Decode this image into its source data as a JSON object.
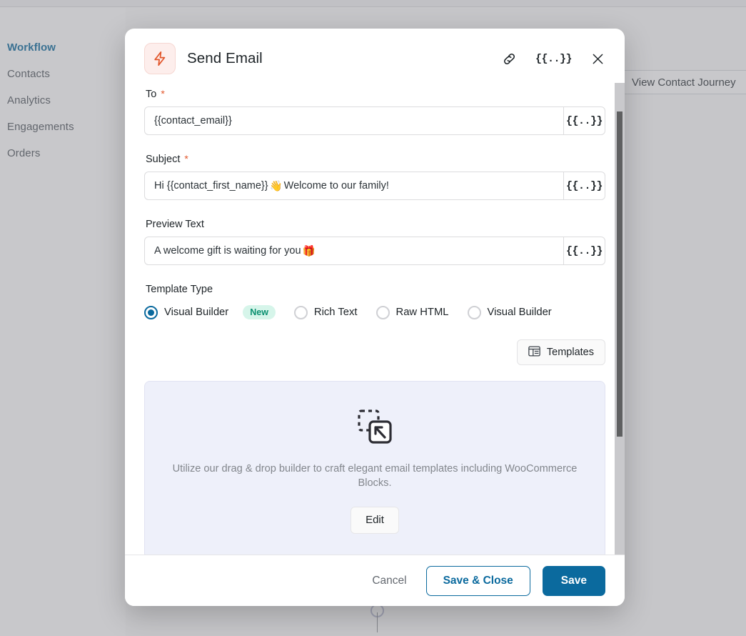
{
  "background": {
    "sidebar": {
      "items": [
        {
          "label": "Workflow",
          "active": true
        },
        {
          "label": "Contacts",
          "active": false
        },
        {
          "label": "Analytics",
          "active": false
        },
        {
          "label": "Engagements",
          "active": false
        },
        {
          "label": "Orders",
          "active": false
        }
      ]
    },
    "canvas": {
      "view_journey_label": "View Contact Journey"
    }
  },
  "modal": {
    "icon": "lightning-bolt-icon",
    "title": "Send Email",
    "header_actions": {
      "link_icon": "link-icon",
      "merge_tag_icon": "{{..}}",
      "close_icon": "close-icon"
    },
    "fields": {
      "to": {
        "label": "To",
        "required": "*",
        "value": "{{contact_email}}",
        "tag_button": "{{..}}"
      },
      "subject": {
        "label": "Subject",
        "required": "*",
        "value_before": "Hi {{contact_first_name}}",
        "emoji": "👋",
        "value_after": "Welcome to our family!",
        "tag_button": "{{..}}"
      },
      "preview_text": {
        "label": "Preview Text",
        "value_before": "A welcome gift is waiting for you",
        "emoji": "🎁",
        "tag_button": "{{..}}"
      }
    },
    "template_type": {
      "label": "Template Type",
      "options": [
        {
          "label": "Visual Builder",
          "checked": true,
          "badge": "New"
        },
        {
          "label": "Rich Text",
          "checked": false,
          "badge": ""
        },
        {
          "label": "Raw HTML",
          "checked": false,
          "badge": ""
        },
        {
          "label": "Visual Builder",
          "checked": false,
          "badge": ""
        }
      ]
    },
    "templates_button": {
      "label": "Templates",
      "icon": "layout-template-icon"
    },
    "preview_panel": {
      "icon": "drag-drop-icon",
      "description": "Utilize our drag & drop builder to craft elegant email templates including WooCommerce Blocks.",
      "edit_label": "Edit"
    },
    "footer": {
      "cancel_label": "Cancel",
      "save_close_label": "Save & Close",
      "save_label": "Save"
    }
  },
  "colors": {
    "accent_blue": "#0b6a9e",
    "bolt_red": "#e2562b",
    "badge_green": "#0a9070",
    "badge_bg": "#d6f5ea",
    "panel_bg": "#eef0fa"
  }
}
